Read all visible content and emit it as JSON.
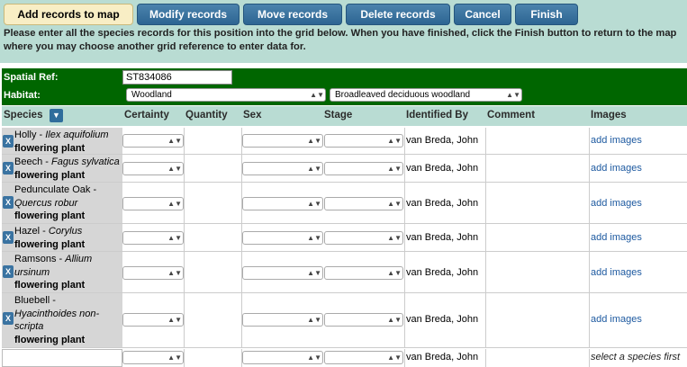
{
  "toolbar": {
    "tabs": [
      {
        "label": "Add records to map",
        "active": true
      },
      {
        "label": "Modify records",
        "active": false
      },
      {
        "label": "Move records",
        "active": false
      },
      {
        "label": "Delete records",
        "active": false
      },
      {
        "label": "Cancel",
        "active": false
      },
      {
        "label": "Finish",
        "active": false
      }
    ],
    "instructions": "Please enter all the species records for this position into the grid below. When you have finished, click the Finish button to return to the map where you may choose another grid reference to enter data for."
  },
  "form": {
    "spatial_ref_label": "Spatial Ref:",
    "spatial_ref_value": "ST834086",
    "habitat_label": "Habitat:",
    "habitat_value": "Woodland",
    "habitat_sub_value": "Broadleaved deciduous woodland"
  },
  "grid": {
    "headers": {
      "species": "Species",
      "certainty": "Certainty",
      "quantity": "Quantity",
      "sex": "Sex",
      "stage": "Stage",
      "identified_by": "Identified By",
      "comment": "Comment",
      "images": "Images"
    },
    "remove_label": "X",
    "sort_icon": "chevron-down-icon",
    "rows": [
      {
        "common": "Holly",
        "sep": " - ",
        "latin": "Ilex aquifolium",
        "group": "flowering plant",
        "identified_by": "van Breda, John",
        "images": "add images"
      },
      {
        "common": "Beech",
        "sep": " - ",
        "latin": "Fagus sylvatica",
        "group": "flowering plant",
        "identified_by": "van Breda, John",
        "images": "add images"
      },
      {
        "common": "Pedunculate Oak",
        "sep": " - ",
        "latin": "Quercus robur",
        "group": "flowering plant",
        "identified_by": "van Breda, John",
        "images": "add images"
      },
      {
        "common": "Hazel",
        "sep": " - ",
        "latin": "Corylus",
        "group": "flowering plant",
        "identified_by": "van Breda, John",
        "images": "add images"
      },
      {
        "common": "Ramsons",
        "sep": " - ",
        "latin": "Allium ursinum",
        "group": "flowering plant",
        "identified_by": "van Breda, John",
        "images": "add images"
      },
      {
        "common": "Bluebell",
        "sep": " - ",
        "latin": "Hyacinthoides non-scripta",
        "group": "flowering plant",
        "identified_by": "van Breda, John",
        "images": "add images"
      }
    ],
    "new_row": {
      "identified_by": "van Breda, John",
      "images_note": "select a species first"
    }
  },
  "colors": {
    "toolbar_bg": "#b9dcd3",
    "button_blue": "#2d6592",
    "form_green": "#006600",
    "link_blue": "#1e5aa0"
  }
}
